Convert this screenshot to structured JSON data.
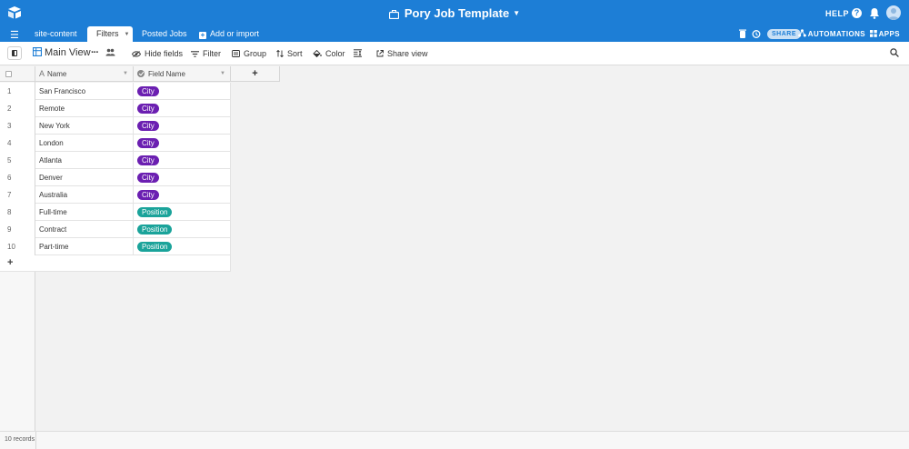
{
  "header": {
    "base_title": "Pory Job Template",
    "help_label": "HELP"
  },
  "tabs": {
    "site_content": "site-content",
    "filters": "Filters",
    "posted_jobs": "Posted Jobs",
    "add_import": "Add or import"
  },
  "tabbar_right": {
    "share_label": "SHARE",
    "automations_label": "AUTOMATIONS",
    "apps_label": "APPS"
  },
  "toolbar": {
    "view_name": "Main View",
    "hide_fields": "Hide fields",
    "filter": "Filter",
    "group": "Group",
    "sort": "Sort",
    "color": "Color",
    "share_view": "Share view"
  },
  "table": {
    "columns": [
      "Name",
      "Field Name"
    ],
    "rows": [
      {
        "num": "1",
        "name": "San Francisco",
        "field": "City"
      },
      {
        "num": "2",
        "name": "Remote",
        "field": "City"
      },
      {
        "num": "3",
        "name": "New York",
        "field": "City"
      },
      {
        "num": "4",
        "name": "London",
        "field": "City"
      },
      {
        "num": "5",
        "name": "Atlanta",
        "field": "City"
      },
      {
        "num": "6",
        "name": "Denver",
        "field": "City"
      },
      {
        "num": "7",
        "name": "Australia",
        "field": "City"
      },
      {
        "num": "8",
        "name": "Full-time",
        "field": "Position"
      },
      {
        "num": "9",
        "name": "Contract",
        "field": "Position"
      },
      {
        "num": "10",
        "name": "Part-time",
        "field": "Position"
      }
    ]
  },
  "footer": {
    "record_count": "10 records"
  },
  "colors": {
    "brand_blue": "#1d7ed6",
    "city_pill": "#6b1fb1",
    "position_pill": "#1aa39a"
  }
}
